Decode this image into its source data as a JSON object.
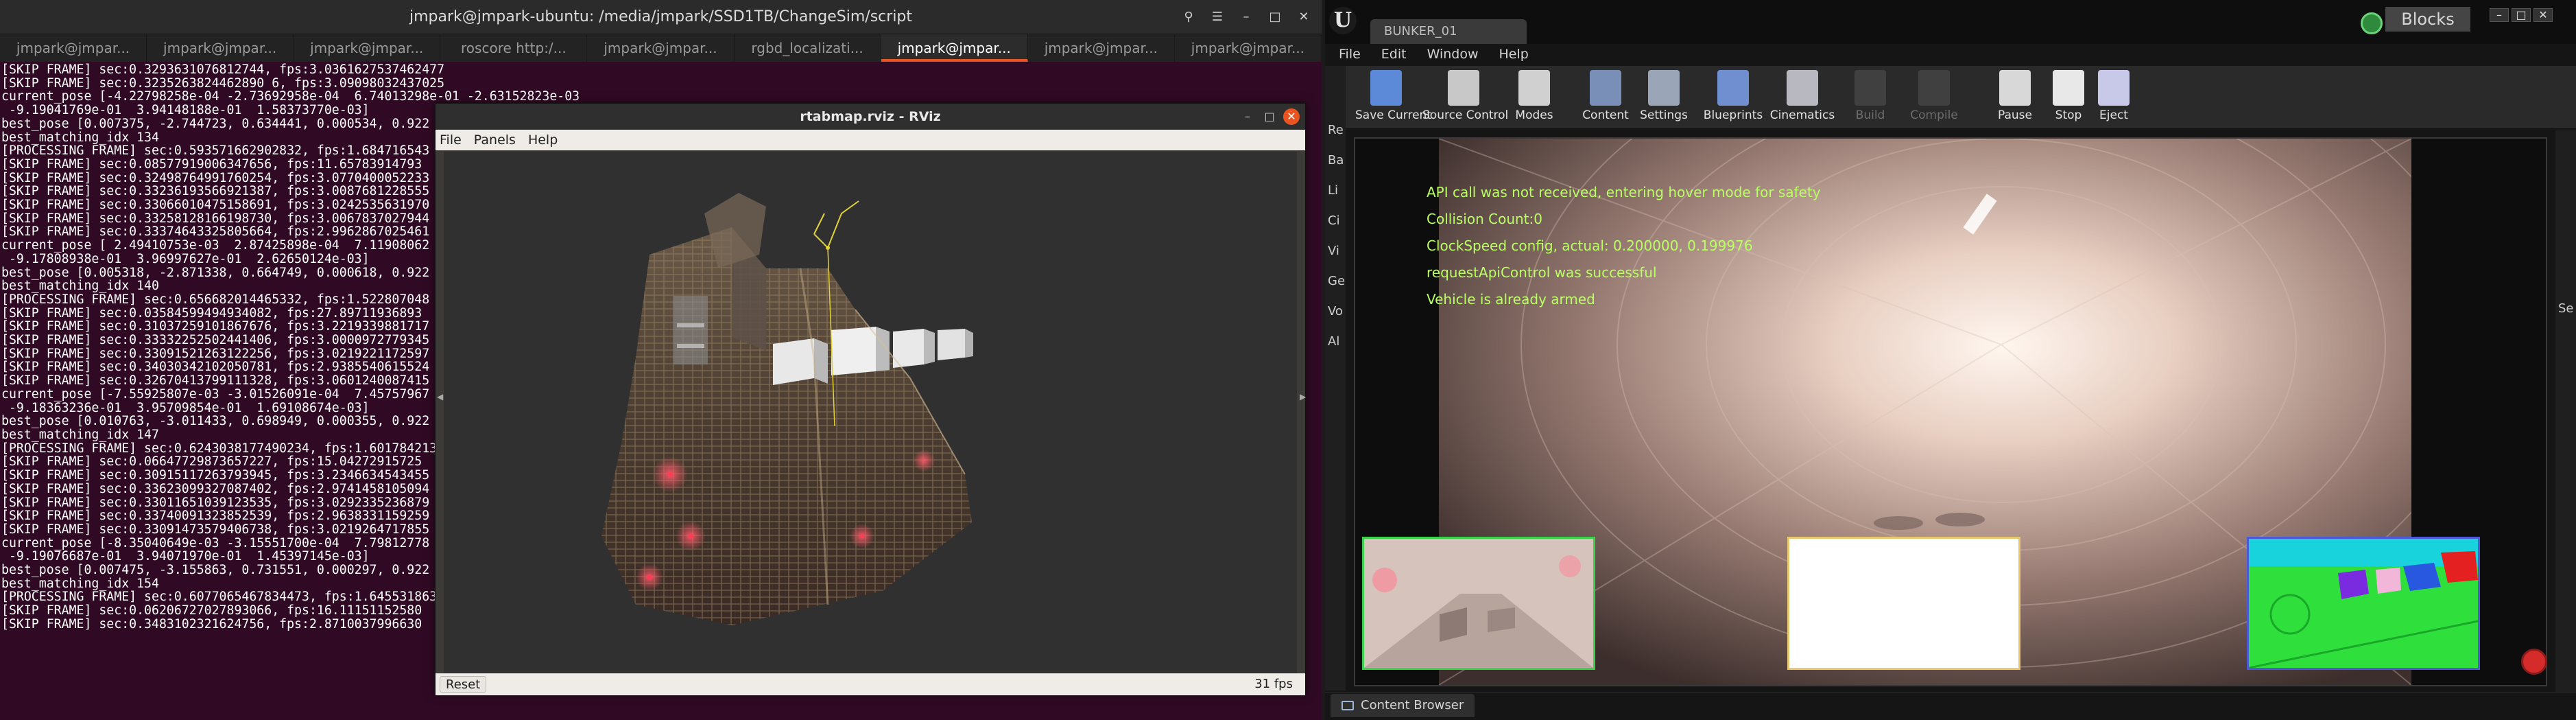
{
  "terminal": {
    "title": "jmpark@jmpark-ubuntu: /media/jmpark/SSD1TB/ChangeSim/script",
    "tabs": [
      "jmpark@jmpar...",
      "jmpark@jmpar...",
      "jmpark@jmpar...",
      "roscore http:/...",
      "jmpark@jmpar...",
      "rgbd_localizati...",
      "jmpark@jmpar...",
      "jmpark@jmpar...",
      "jmpark@jmpar..."
    ],
    "active_tab": 6,
    "lines": [
      "[SKIP FRAME] sec:0.3293631076812744, fps:3.0361627537462477",
      "[SKIP FRAME] sec:0.3235263824462890 6, fps:3.09098032437025",
      "current_pose [-4.22798258e-04 -2.73692958e-04  6.74013298e-01 -2.63152823e-03",
      " -9.19041769e-01  3.94148188e-01  1.58373770e-03]",
      "best_pose [0.007375, -2.744723, 0.634441, 0.000534, 0.922",
      "best_matching_idx 134",
      "[PROCESSING FRAME] sec:0.593571662902832, fps:1.684716543",
      "[SKIP FRAME] sec:0.08577919006347656, fps:11.65783914793",
      "[SKIP FRAME] sec:0.32498764991760254, fps:3.0770400052233",
      "[SKIP FRAME] sec:0.33236193566921387, fps:3.0087681228555",
      "[SKIP FRAME] sec:0.33066010475158691, fps:3.0242535631970",
      "[SKIP FRAME] sec:0.33258128166198730, fps:3.0067837027944",
      "[SKIP FRAME] sec:0.33374643325805664, fps:2.9962867025461",
      "current_pose [ 2.49410753e-03  2.87425898e-04  7.11908062",
      " -9.17808938e-01  3.96997627e-01  2.62650124e-03]",
      "best_pose [0.005318, -2.871338, 0.664749, 0.000618, 0.922",
      "best_matching_idx 140",
      "[PROCESSING FRAME] sec:0.656682014465332, fps:1.522807048",
      "[SKIP FRAME] sec:0.03584599494934082, fps:27.89711936893",
      "[SKIP FRAME] sec:0.31037259101867676, fps:3.2219339881717",
      "[SKIP FRAME] sec:0.33332252502441406, fps:3.0000972779345",
      "[SKIP FRAME] sec:0.33091521263122256, fps:3.0219221172597",
      "[SKIP FRAME] sec:0.34030342102050781, fps:2.9385540615524",
      "[SKIP FRAME] sec:0.32670413799111328, fps:3.0601240087415",
      "current_pose [-7.55925807e-03 -3.01526091e-04  7.45757967",
      " -9.18363236e-01  3.95709854e-01  1.69108674e-03]",
      "best_pose [0.010763, -3.011433, 0.698949, 0.000355, 0.922",
      "best_matching_idx 147",
      "[PROCESSING FRAME] sec:0.6243038177490234, fps:1.601784213",
      "[SKIP FRAME] sec:0.06647729873657227, fps:15.04272915725",
      "[SKIP FRAME] sec:0.30915117263793945, fps:3.2346634543455",
      "[SKIP FRAME] sec:0.33623099327087402, fps:2.9741458105094",
      "[SKIP FRAME] sec:0.33011651039123535, fps:3.0292335236879",
      "[SKIP FRAME] sec:0.33740091323852539, fps:2.9638331159259",
      "[SKIP FRAME] sec:0.33091473579406738, fps:3.0219264717855",
      "current_pose [-8.35040649e-03 -3.15551700e-04  7.79812778",
      " -9.19076687e-01  3.94071970e-01  1.45397145e-03]",
      "best_pose [0.007475, -3.155863, 0.731551, 0.000297, 0.922",
      "best_matching_idx 154",
      "[PROCESSING FRAME] sec:0.6077065467834473, fps:1.645531863",
      "[SKIP FRAME] sec:0.06206727027893066, fps:16.11151152580",
      "[SKIP FRAME] sec:0.3483102321624756, fps:2.8710037996630",
      ""
    ]
  },
  "rviz": {
    "title": "rtabmap.rviz - RViz",
    "menu": [
      "File",
      "Panels",
      "Help"
    ],
    "reset_label": "Reset",
    "fps_label": "31 fps"
  },
  "unreal": {
    "level_tab": "BUNKER_01",
    "project_name": "Blocks",
    "menu": [
      "File",
      "Edit",
      "Window",
      "Help"
    ],
    "toolbar": [
      {
        "label": "Save Current",
        "icon": "save-icon",
        "enabled": true
      },
      {
        "label": "Source Control",
        "icon": "source-control-icon",
        "enabled": true
      },
      {
        "label": "Modes",
        "icon": "modes-icon",
        "enabled": true
      },
      {
        "label": "Content",
        "icon": "content-icon",
        "enabled": true
      },
      {
        "label": "Settings",
        "icon": "settings-icon",
        "enabled": true
      },
      {
        "label": "Blueprints",
        "icon": "blueprints-icon",
        "enabled": true
      },
      {
        "label": "Cinematics",
        "icon": "cinematics-icon",
        "enabled": true
      },
      {
        "label": "Build",
        "icon": "build-icon",
        "enabled": false
      },
      {
        "label": "Compile",
        "icon": "compile-icon",
        "enabled": false
      },
      {
        "label": "Pause",
        "icon": "pause-icon",
        "enabled": true
      },
      {
        "label": "Stop",
        "icon": "stop-icon",
        "enabled": true
      },
      {
        "label": "Eject",
        "icon": "eject-icon",
        "enabled": true
      }
    ],
    "left_strip_labels": [
      "Re",
      "Ba",
      "Li",
      "Ci",
      "Vi",
      "Ge",
      "Vo",
      "Al"
    ],
    "right_strip_label": "Se",
    "hud_messages": [
      "API call was not received, entering hover mode for safety",
      "Collision Count:0",
      "ClockSpeed config, actual: 0.200000, 0.199976",
      "requestApiControl was successful",
      "Vehicle is already armed"
    ],
    "hud_color": "#b9ff63",
    "content_browser_label": "Content Browser"
  }
}
